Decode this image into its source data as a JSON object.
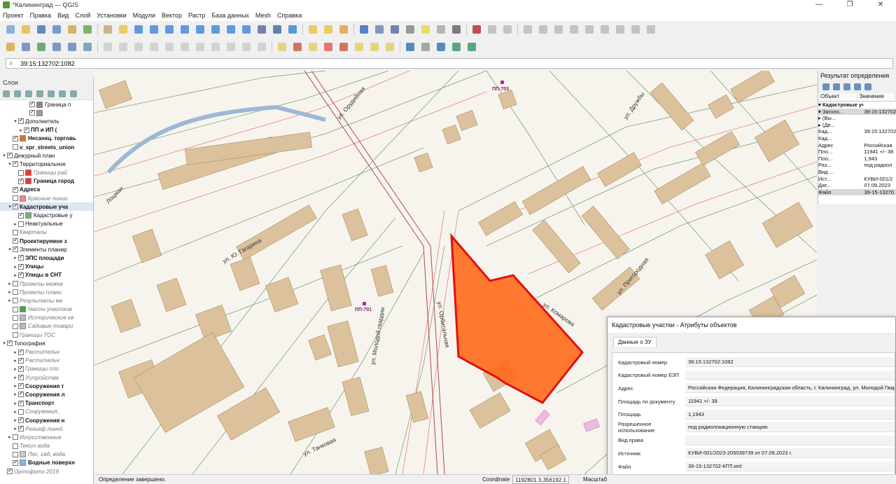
{
  "window": {
    "title": "*Калининград — QGIS",
    "minimize": "—",
    "restore": "❐",
    "close": "✕"
  },
  "menu": [
    "Проект",
    "Правка",
    "Вид",
    "Слой",
    "Установки",
    "Модули",
    "Вектор",
    "Растр",
    "База данных",
    "Mesh",
    "Справка"
  ],
  "search": {
    "value": "39:15:132702:1082"
  },
  "layers_panel": {
    "title": "Слои",
    "items": [
      {
        "label": "Граница п",
        "indent": 4,
        "checked": true,
        "style": "",
        "sym": "#888"
      },
      {
        "label": "",
        "indent": 4,
        "checked": true,
        "style": "",
        "sym": "#999"
      },
      {
        "label": "Дополнитель",
        "indent": 2,
        "checked": true,
        "style": "",
        "sym": "none",
        "arrow": "▾"
      },
      {
        "label": "ПП и ИП (",
        "indent": 3,
        "checked": true,
        "style": "b",
        "sym": "none",
        "arrow": "▸"
      },
      {
        "label": "Несанкц. торговь",
        "indent": 1,
        "checked": true,
        "style": "b",
        "sym": "#d4782a"
      },
      {
        "label": "v_spr_streets_union",
        "indent": 1,
        "checked": false,
        "style": "b",
        "sym": "none"
      },
      {
        "label": "Дежурный план",
        "indent": 0,
        "checked": true,
        "style": "",
        "sym": "none",
        "arrow": "▾"
      },
      {
        "label": "Территориальное",
        "indent": 1,
        "checked": true,
        "style": "",
        "sym": "none",
        "arrow": "▾"
      },
      {
        "label": "Границы рай",
        "indent": 2,
        "checked": false,
        "style": "i",
        "sym": "#e33"
      },
      {
        "label": "Граница город",
        "indent": 2,
        "checked": true,
        "style": "b",
        "sym": "#e33"
      },
      {
        "label": "Адреса",
        "indent": 1,
        "checked": true,
        "style": "b",
        "sym": "none"
      },
      {
        "label": "Красные линии",
        "indent": 1,
        "checked": false,
        "style": "i",
        "sym": "#e88"
      },
      {
        "label": "Кадастровые уча",
        "indent": 1,
        "checked": true,
        "style": "b",
        "sym": "none",
        "arrow": "▾",
        "sel": true
      },
      {
        "label": "Кадастровые у",
        "indent": 2,
        "checked": true,
        "style": "",
        "sym": "#7ab07a"
      },
      {
        "label": "Неактуальные",
        "indent": 2,
        "checked": false,
        "style": "",
        "sym": "none",
        "arrow": "▸"
      },
      {
        "label": "Кварталы",
        "indent": 1,
        "checked": false,
        "style": "i",
        "sym": "none"
      },
      {
        "label": "Проектируемое з",
        "indent": 1,
        "checked": true,
        "style": "b",
        "sym": "none"
      },
      {
        "label": "Элементы планир",
        "indent": 1,
        "checked": true,
        "style": "",
        "sym": "none",
        "arrow": "▾"
      },
      {
        "label": "ЭПС площади",
        "indent": 2,
        "checked": true,
        "style": "b",
        "sym": "none",
        "arrow": "▸"
      },
      {
        "label": "Улицы",
        "indent": 2,
        "checked": true,
        "style": "b",
        "sym": "none",
        "arrow": "▸"
      },
      {
        "label": "Улицы в СНТ",
        "indent": 2,
        "checked": true,
        "style": "b",
        "sym": "none",
        "arrow": "▸"
      },
      {
        "label": "Проекты межев",
        "indent": 1,
        "checked": false,
        "style": "i",
        "sym": "none",
        "arrow": "▸"
      },
      {
        "label": "Проекты плани",
        "indent": 1,
        "checked": false,
        "style": "i",
        "sym": "none",
        "arrow": "▸"
      },
      {
        "label": "Результаты ме",
        "indent": 1,
        "checked": false,
        "style": "i",
        "sym": "none",
        "arrow": "▸"
      },
      {
        "label": "Части участков",
        "indent": 1,
        "checked": false,
        "style": "i",
        "sym": "#4a4"
      },
      {
        "label": "Исторические кв",
        "indent": 1,
        "checked": false,
        "style": "i",
        "sym": "#bbb"
      },
      {
        "label": "Садовые товари",
        "indent": 1,
        "checked": false,
        "style": "i",
        "sym": "#bbb"
      },
      {
        "label": "Границы ТОС",
        "indent": 1,
        "checked": false,
        "style": "i",
        "sym": "none"
      },
      {
        "label": "Топография",
        "indent": 0,
        "checked": true,
        "style": "",
        "sym": "none",
        "arrow": "▾"
      },
      {
        "label": "Растительн",
        "indent": 2,
        "checked": true,
        "style": "i",
        "sym": "none",
        "arrow": "▸"
      },
      {
        "label": "Растительн",
        "indent": 2,
        "checked": true,
        "style": "i",
        "sym": "none",
        "arrow": "▸"
      },
      {
        "label": "Границы пло",
        "indent": 2,
        "checked": true,
        "style": "i",
        "sym": "none",
        "arrow": "▸"
      },
      {
        "label": "Устройства",
        "indent": 2,
        "checked": true,
        "style": "i",
        "sym": "none",
        "arrow": "▸"
      },
      {
        "label": "Сооружения т",
        "indent": 2,
        "checked": true,
        "style": "b",
        "sym": "none",
        "arrow": "▸"
      },
      {
        "label": "Сооружения л",
        "indent": 2,
        "checked": true,
        "style": "b",
        "sym": "none",
        "arrow": "▸"
      },
      {
        "label": "Транспорт",
        "indent": 2,
        "checked": true,
        "style": "b",
        "sym": "none",
        "arrow": "▸"
      },
      {
        "label": "Сооружения_",
        "indent": 2,
        "checked": false,
        "style": "i",
        "sym": "none",
        "arrow": "▸"
      },
      {
        "label": "Сооружения н",
        "indent": 2,
        "checked": true,
        "style": "b",
        "sym": "none",
        "arrow": "▸"
      },
      {
        "label": "Рельеф линей",
        "indent": 2,
        "checked": true,
        "style": "i",
        "sym": "none",
        "arrow": "▸"
      },
      {
        "label": "Искусственные",
        "indent": 1,
        "checked": false,
        "style": "i",
        "sym": "none",
        "arrow": "▸"
      },
      {
        "label": "Текст вода",
        "indent": 1,
        "checked": false,
        "style": "i",
        "sym": "none"
      },
      {
        "label": "Лес, сад, вода",
        "indent": 1,
        "checked": false,
        "style": "i",
        "sym": "#ccc"
      },
      {
        "label": "Водные поверхн",
        "indent": 1,
        "checked": true,
        "style": "b",
        "sym": "#89b4e0"
      },
      {
        "label": "Ортофото 2019",
        "indent": 0,
        "checked": true,
        "style": "i",
        "sym": "none"
      }
    ]
  },
  "map": {
    "street_labels": [
      "ул. Ю. Гагарина",
      "ул. Молодой гвардии",
      "ул. Орбитальная",
      "ул. Комарова",
      "ул. Пригородная",
      "ул. Дружбы",
      "ул. Танковая",
      "ул. Орудийная",
      "Лоцман"
    ],
    "plan_labels": [
      "ПП-701",
      "ПП-703"
    ],
    "selected_parcel_color": "#ff6a1a",
    "selected_parcel_outline": "#e21010"
  },
  "identify_panel": {
    "title": "Результат определения",
    "col_object": "Объект",
    "col_value": "Значение",
    "rows": [
      {
        "k": "▾ Кадастровые участки",
        "v": "",
        "bold": true
      },
      {
        "k": "  ▾ Заголо...",
        "v": "39:15:132702",
        "hl": true
      },
      {
        "k": "    ▸ (Вы...",
        "v": ""
      },
      {
        "k": "    ▸ (Де...",
        "v": ""
      },
      {
        "k": "      Кад...",
        "v": "39:15:132702"
      },
      {
        "k": "      Кад...",
        "v": ""
      },
      {
        "k": "      Адрес",
        "v": "Российская"
      },
      {
        "k": "      Пло...",
        "v": "11941 +/- 38"
      },
      {
        "k": "      Пло...",
        "v": "1,943"
      },
      {
        "k": "      Раз...",
        "v": "под радиол"
      },
      {
        "k": "      Вид ...",
        "v": ""
      },
      {
        "k": "      Ист...",
        "v": "КУВИ-001/2"
      },
      {
        "k": "      Дат...",
        "v": "07.09.2023"
      },
      {
        "k": "      Файл",
        "v": "39-15-13270",
        "hl": true
      }
    ]
  },
  "attr_dialog": {
    "title": "Кадастровые участки - Атрибуты объектов",
    "tab": "Данные о ЗУ",
    "fields": [
      {
        "k": "Кадастровый номер",
        "v": "39:15:132702:1082"
      },
      {
        "k": "Кадастровый номер ЕЗП",
        "v": ""
      },
      {
        "k": "Адрес",
        "v": "Российская Федерация, Калининградская область, г. Калининград, ул. Молодой Гвар"
      },
      {
        "k": "Площадь по документу",
        "v": "11941 +/- 38"
      },
      {
        "k": "Площадь",
        "v": "1,1943"
      },
      {
        "k": "Разрешенное использование",
        "v": "под радиолокационную станцию"
      },
      {
        "k": "Вид права",
        "v": ""
      },
      {
        "k": "Источник",
        "v": "КУВИ-001/2023-205039739 от 07.09.2023 г."
      },
      {
        "k": "Файл",
        "v": "39-15-132702-КПТ.xml"
      }
    ]
  },
  "status": {
    "message": "Определение завершено.",
    "coord_label": "Coordinate",
    "coord_value": "1192801.3,356192.1",
    "scale_label": "Масштаб"
  }
}
